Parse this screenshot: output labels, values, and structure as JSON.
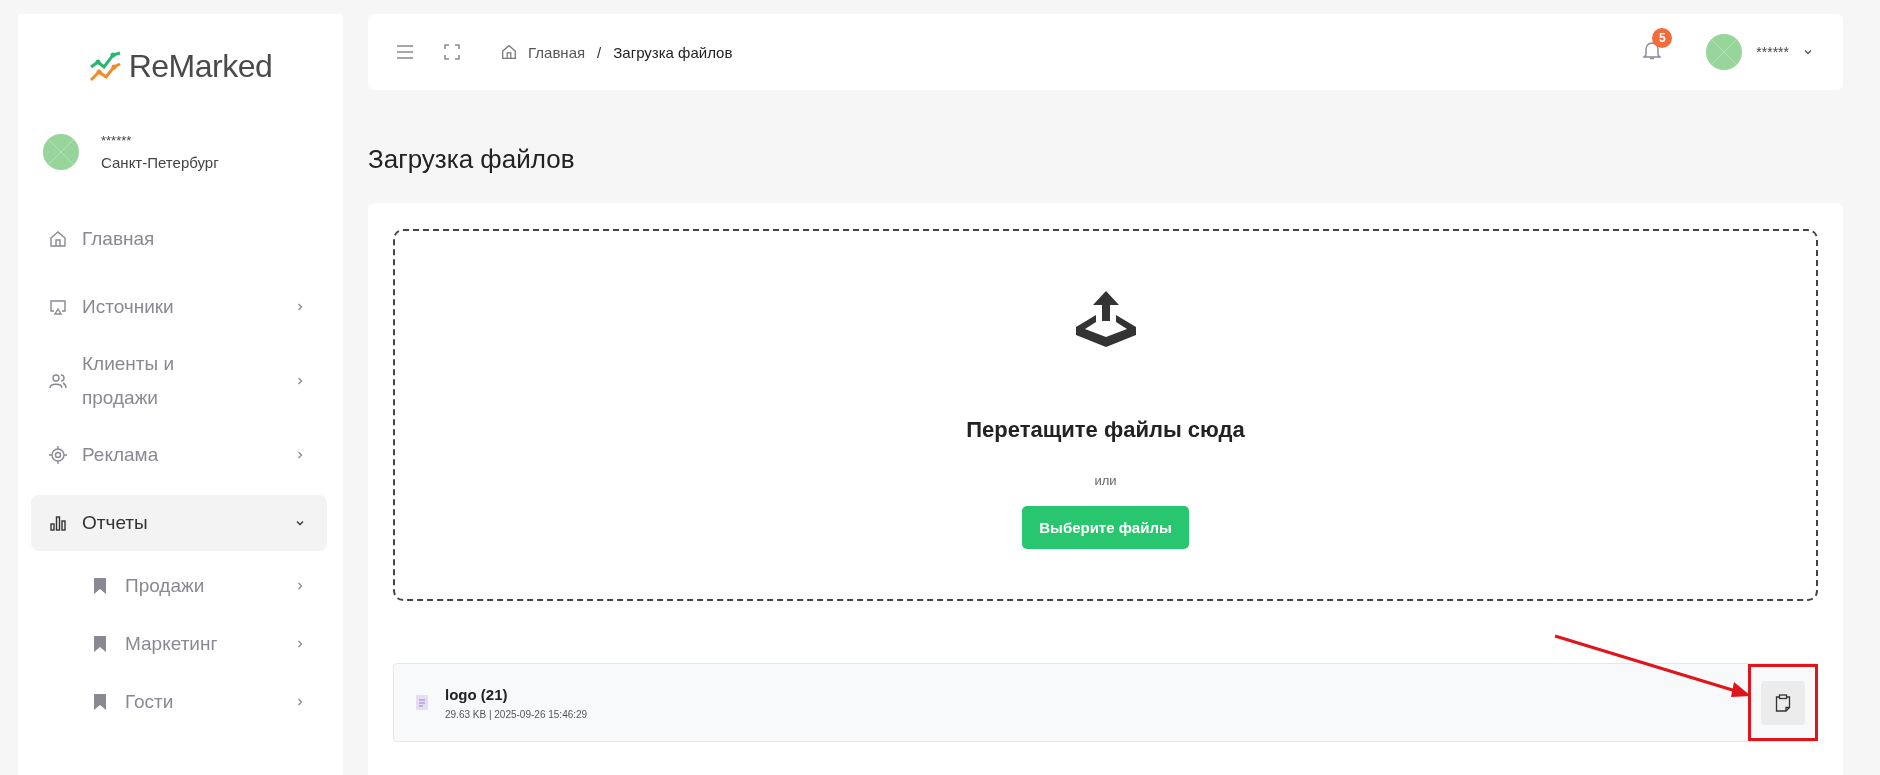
{
  "sidebar": {
    "logo": "ReMarked",
    "user": {
      "name": "******",
      "city": "Санкт-Петербург"
    },
    "items": [
      {
        "label": "Главная",
        "selected": false
      },
      {
        "label": "Источники",
        "selected": false,
        "expanded": false
      },
      {
        "label": "Клиенты и продажи",
        "selected": false,
        "expanded": false
      },
      {
        "label": "Реклама",
        "selected": false,
        "expanded": false
      },
      {
        "label": "Отчеты",
        "selected": true,
        "expanded": true,
        "children": [
          {
            "label": "Продажи",
            "selected": false
          },
          {
            "label": "Маркетинг",
            "selected": false
          },
          {
            "label": "Гости",
            "selected": false
          }
        ]
      }
    ]
  },
  "header": {
    "separator": "/",
    "breadcrumbs": [
      "Главная",
      "Загрузка файлов"
    ],
    "notifications": "5",
    "user": "******"
  },
  "page_title": "Загрузка файлов",
  "dropzone": {
    "title": "Перетащите файлы сюда",
    "or": "или",
    "button": "Выберите файлы"
  },
  "files": [
    {
      "name": "logo (21)",
      "meta": "29.63 KB | 2025-09-26 15:46:29"
    }
  ]
}
